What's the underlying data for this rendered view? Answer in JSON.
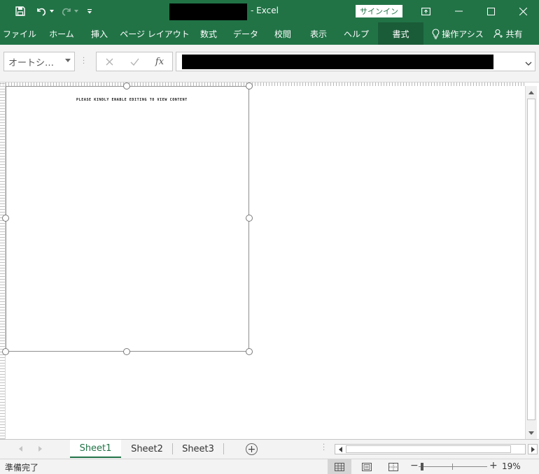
{
  "titlebar": {
    "app_suffix": "- Excel",
    "signin_label": "サインイン"
  },
  "ribbon": {
    "tabs": [
      "ファイル",
      "ホーム",
      "挿入",
      "ページ レイアウト",
      "数式",
      "データ",
      "校閲",
      "表示",
      "ヘルプ",
      "書式"
    ],
    "active_tab": "書式",
    "tell_me": "操作アシス",
    "share": "共有"
  },
  "formula_bar": {
    "name_box": "オートシ…",
    "fx_label": "fx"
  },
  "sheet": {
    "shape_text": "PLEASE KINDLY ENABLE EDITING TO VIEW CONTENT"
  },
  "sheet_tabs": {
    "tabs": [
      "Sheet1",
      "Sheet2",
      "Sheet3"
    ],
    "active": "Sheet1"
  },
  "status_bar": {
    "status": "準備完了",
    "zoom": "19%"
  },
  "colors": {
    "brand": "#217346",
    "active_tab": "#1a5c38"
  }
}
